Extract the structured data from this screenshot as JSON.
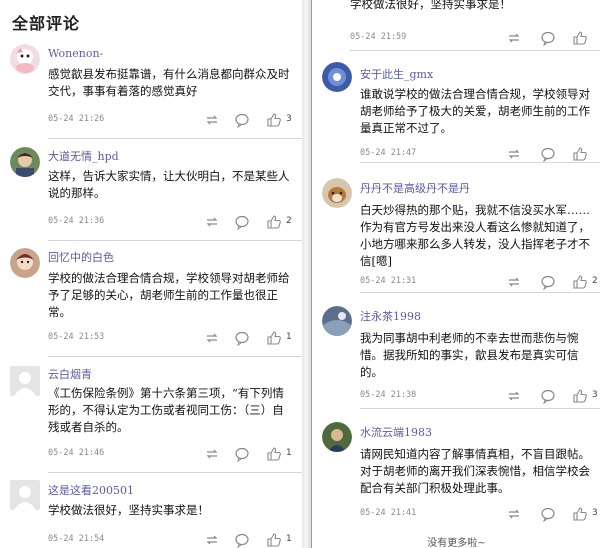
{
  "header": {
    "title": "全部评论"
  },
  "left_comments": [
    {
      "user": "Wonenon-",
      "text": "感觉歙县发布挺靠谱，有什么消息都向群众及时交代，事事有着落的感觉真好",
      "time": "05-24 21:26",
      "likes": "3"
    },
    {
      "user": "大道无情_hpd",
      "text": "这样，告诉大家实情，让大伙明白，不是某些人说的那样。",
      "time": "05-24 21:36",
      "likes": "2"
    },
    {
      "user": "回忆中的白色",
      "text": "学校的做法合理合情合规，学校领导对胡老师给予了足够的关心，胡老师生前的工作量也很正常。",
      "time": "05-24 21:53",
      "likes": "1"
    },
    {
      "user": "云白烟青",
      "text": "《工伤保险条例》第十六条第三项，“有下列情形的，不得认定为工伤或者视同工伤：（三）自残或者自杀的。",
      "time": "05-24 21:46",
      "likes": "1"
    },
    {
      "user": "这是这看200501",
      "text": "学校做法很好，坚持实事求是！",
      "time": "05-24 21:54",
      "likes": "1"
    }
  ],
  "right_comments": [
    {
      "user": "",
      "text": "学校做法很好，坚持实事求是！",
      "time": "05-24 21:59",
      "likes": ""
    },
    {
      "user": "安于此生_gmx",
      "text": "谁敢说学校的做法合理合情合规，学校领导对胡老师给予了极大的关爱，胡老师生前的工作量真正常不过了。",
      "time": "05-24 21:47",
      "likes": ""
    },
    {
      "user": "丹丹不是高级丹不是丹",
      "text": "白天炒得热的那个贴，我就不信没买水军……作为有官方号发出来没人看这么惨就知道了，小地方哪来那么多人转发，没人指挥老子才不信[嗯]",
      "time": "05-24 21:31",
      "likes": "2"
    },
    {
      "user": "注永茶1998",
      "text": "我为同事胡中利老师的不幸去世而悲伤与惋惜。据我所知的事实，歙县发布是真实可信的。",
      "time": "05-24 21:38",
      "likes": "3"
    },
    {
      "user": "水流云端1983",
      "text": "请网民知道内容了解事情真相，不盲目跟帖。对于胡老师的离开我们深表惋惜，相信学校会配合有关部门积极处理此事。",
      "time": "05-24 21:41",
      "likes": "3"
    }
  ],
  "footer": {
    "text": "没有更多啦~"
  },
  "icons": {
    "repost": "repost-icon",
    "comment": "comment-icon",
    "like": "thumbs-up-icon"
  },
  "colors": {
    "username": "#5a5aa6",
    "meta": "#8a8a8a",
    "separator": "#d6d6d6"
  }
}
